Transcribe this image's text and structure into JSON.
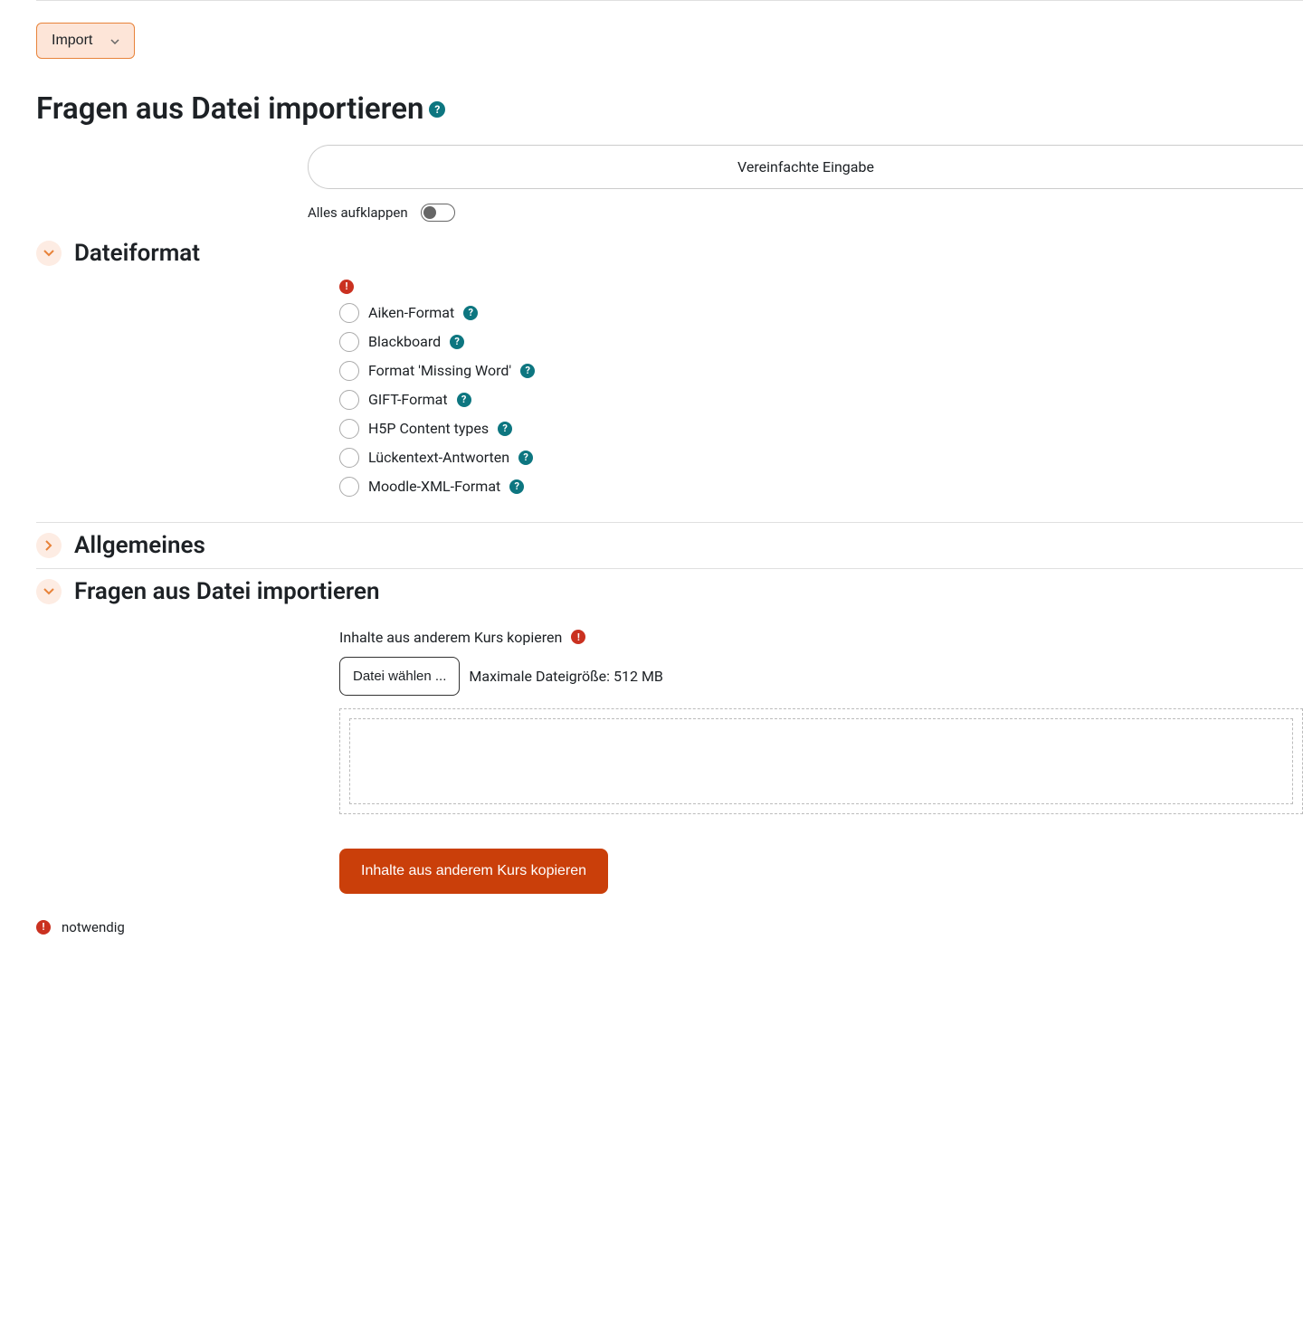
{
  "dropdown": {
    "label": "Import"
  },
  "heading": "Fragen aus Datei importieren",
  "simplified_input": "Vereinfachte Eingabe",
  "expand_all": "Alles aufklappen",
  "sections": {
    "file_format": {
      "title": "Dateiformat",
      "options": [
        "Aiken-Format",
        "Blackboard",
        "Format 'Missing Word'",
        "GIFT-Format",
        "H5P Content types",
        "Lückentext-Antworten",
        "Moodle-XML-Format"
      ]
    },
    "general": {
      "title": "Allgemeines"
    },
    "import_file": {
      "title": "Fragen aus Datei importieren",
      "copy_label": "Inhalte aus anderem Kurs kopieren",
      "choose_file": "Datei wählen ...",
      "max_size": "Maximale Dateigröße: 512 MB",
      "submit": "Inhalte aus anderem Kurs kopieren"
    }
  },
  "required_label": "notwendig"
}
